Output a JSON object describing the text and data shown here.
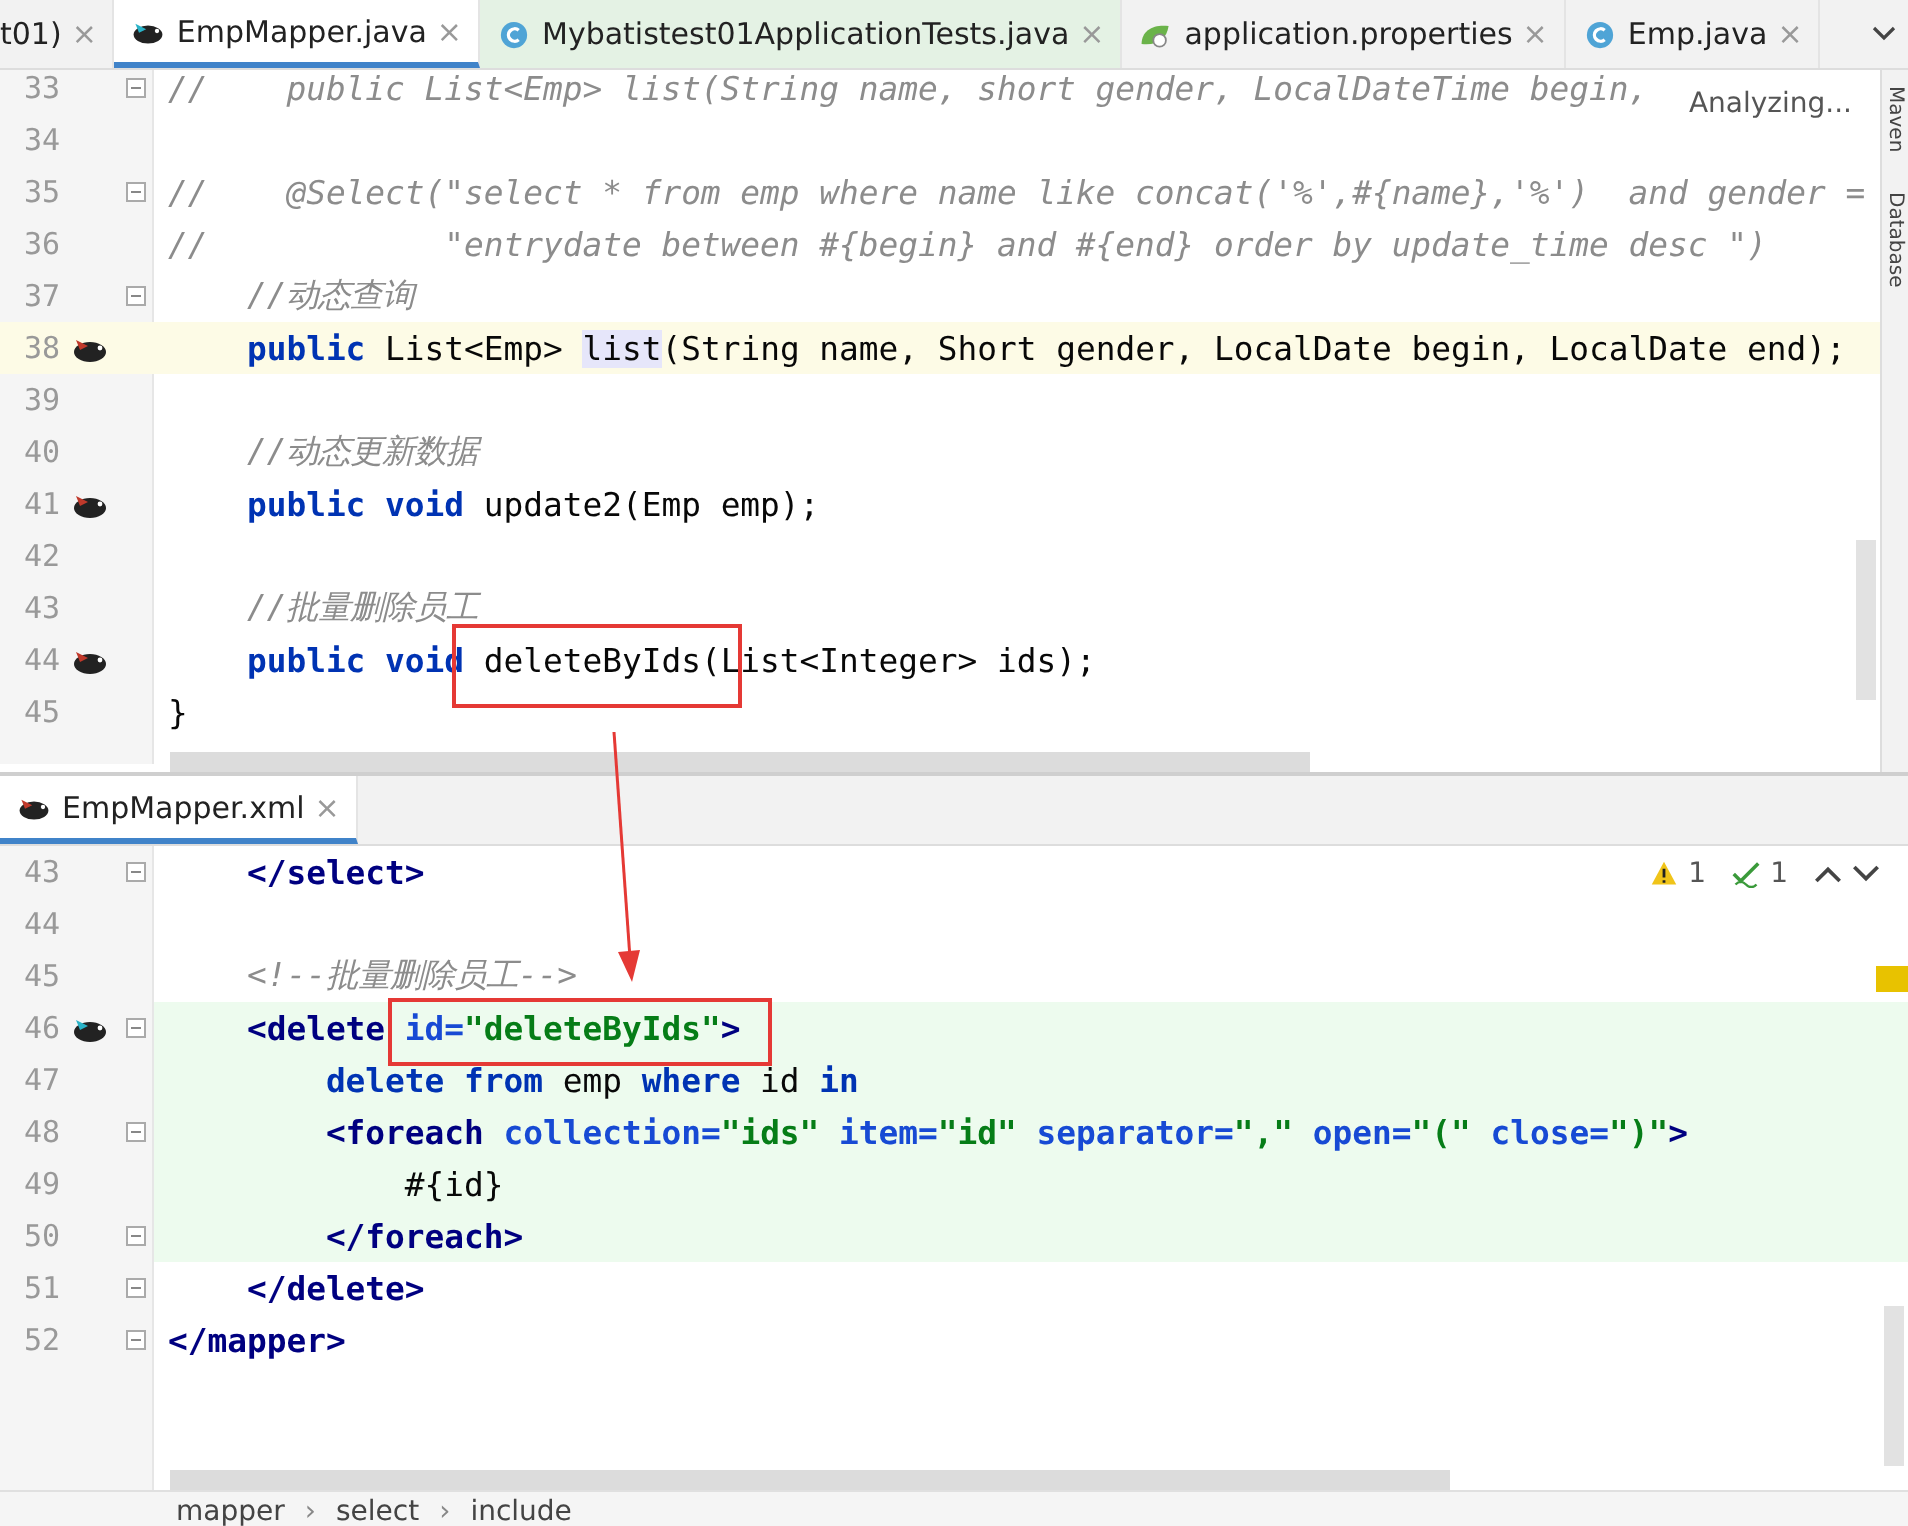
{
  "tabs": [
    {
      "label": "t01)",
      "close": "×",
      "selected": false,
      "kind": "plain",
      "tint": false
    },
    {
      "label": "EmpMapper.java",
      "close": "×",
      "selected": true,
      "kind": "mapper",
      "tint": false
    },
    {
      "label": "Mybatistest01ApplicationTests.java",
      "close": "×",
      "selected": false,
      "kind": "class",
      "tint": true
    },
    {
      "label": "application.properties",
      "close": "×",
      "selected": false,
      "kind": "config",
      "tint": false
    },
    {
      "label": "Emp.java",
      "close": "×",
      "selected": false,
      "kind": "class",
      "tint": false
    }
  ],
  "status_text": "Analyzing...",
  "side_labels": [
    "Maven",
    "Database"
  ],
  "java_editor": {
    "lines": [
      {
        "number": "33",
        "mapped": false,
        "fold": true,
        "current": false,
        "changed": false,
        "tokens": [
          {
            "kind": "comment",
            "text": "//    public List<Emp> list(String name, short gender, LocalDateTime begin,"
          }
        ]
      },
      {
        "number": "34",
        "mapped": false,
        "fold": false,
        "current": false,
        "changed": false
      },
      {
        "number": "35",
        "mapped": false,
        "fold": true,
        "current": false,
        "changed": false,
        "tokens": [
          {
            "kind": "comment",
            "text": "//    @Select(\"select * from emp where name like concat('%',#{name},'%')  and gender ="
          }
        ]
      },
      {
        "number": "36",
        "mapped": false,
        "fold": false,
        "current": false,
        "changed": false,
        "tokens": [
          {
            "kind": "comment",
            "text": "//            \"entrydate between #{begin} and #{end} order by update_time desc \")"
          }
        ]
      },
      {
        "number": "37",
        "mapped": false,
        "fold": true,
        "current": false,
        "changed": false,
        "tokens": [
          {
            "kind": "comment",
            "text": "    //动态查询"
          }
        ]
      },
      {
        "number": "38",
        "mapped": true,
        "fold": false,
        "current": true,
        "changed": false,
        "tokens": [
          {
            "kind": "kw",
            "text": "    public"
          },
          {
            "kind": "text",
            "text": " List<Emp> "
          },
          {
            "kind": "hl",
            "text": "list"
          },
          {
            "kind": "text",
            "text": "(String name, Short gender, LocalDate begin, LocalDate end);"
          }
        ]
      },
      {
        "number": "39",
        "mapped": false,
        "fold": false,
        "current": false,
        "changed": false
      },
      {
        "number": "40",
        "mapped": false,
        "fold": false,
        "current": false,
        "changed": false,
        "tokens": [
          {
            "kind": "comment",
            "text": "    //动态更新数据"
          }
        ]
      },
      {
        "number": "41",
        "mapped": true,
        "fold": false,
        "current": false,
        "changed": false,
        "tokens": [
          {
            "kind": "kw",
            "text": "    public void"
          },
          {
            "kind": "text",
            "text": " update2(Emp emp);"
          }
        ]
      },
      {
        "number": "42",
        "mapped": false,
        "fold": false,
        "current": false,
        "changed": false
      },
      {
        "number": "43",
        "mapped": false,
        "fold": false,
        "current": false,
        "changed": false,
        "tokens": [
          {
            "kind": "comment",
            "text": "    //批量删除员工"
          }
        ]
      },
      {
        "number": "44",
        "mapped": true,
        "fold": false,
        "current": false,
        "changed": false,
        "tokens": [
          {
            "kind": "kw",
            "text": "    public void"
          },
          {
            "kind": "text",
            "text": " deleteByIds(List<Integer> ids);"
          }
        ]
      },
      {
        "number": "45",
        "mapped": false,
        "fold": false,
        "current": false,
        "changed": false,
        "tokens": [
          {
            "kind": "text",
            "text": "}"
          }
        ]
      }
    ]
  },
  "xml_tab": {
    "label": "EmpMapper.xml",
    "close": "×",
    "selected": true
  },
  "inspections": {
    "warnings": "1",
    "typos": "1"
  },
  "xml_editor": {
    "lines": [
      {
        "number": "43",
        "mapped": false,
        "fold": true,
        "current": false,
        "changed": false,
        "tokens": [
          {
            "kind": "tag",
            "text": "    </select>"
          }
        ]
      },
      {
        "number": "44",
        "mapped": false,
        "fold": false,
        "current": false,
        "changed": false
      },
      {
        "number": "45",
        "mapped": false,
        "fold": false,
        "current": false,
        "changed": false,
        "tokens": [
          {
            "kind": "comment",
            "text": "    <!--批量删除员工-->"
          }
        ]
      },
      {
        "number": "46",
        "mapped": true,
        "fold": true,
        "current": false,
        "changed": true,
        "tokens": [
          {
            "kind": "tag",
            "text": "    <delete "
          },
          {
            "kind": "attr",
            "text": "id="
          },
          {
            "kind": "value",
            "text": "\"deleteByIds\""
          },
          {
            "kind": "tag",
            "text": ">"
          }
        ]
      },
      {
        "number": "47",
        "mapped": false,
        "fold": false,
        "current": false,
        "changed": true,
        "tokens": [
          {
            "kind": "kw",
            "text": "        delete from"
          },
          {
            "kind": "text",
            "text": " emp "
          },
          {
            "kind": "kw",
            "text": "where"
          },
          {
            "kind": "text",
            "text": " id "
          },
          {
            "kind": "kw",
            "text": "in"
          }
        ]
      },
      {
        "number": "48",
        "mapped": false,
        "fold": true,
        "current": false,
        "changed": true,
        "tokens": [
          {
            "kind": "tag",
            "text": "        <foreach "
          },
          {
            "kind": "attr",
            "text": "collection="
          },
          {
            "kind": "value",
            "text": "\"ids\" "
          },
          {
            "kind": "attr",
            "text": "item="
          },
          {
            "kind": "value",
            "text": "\"id\" "
          },
          {
            "kind": "attr",
            "text": "separator="
          },
          {
            "kind": "value",
            "text": "\",\" "
          },
          {
            "kind": "attr",
            "text": "open="
          },
          {
            "kind": "value",
            "text": "\"(\" "
          },
          {
            "kind": "attr",
            "text": "close="
          },
          {
            "kind": "value",
            "text": "\")\""
          },
          {
            "kind": "tag",
            "text": ">"
          }
        ]
      },
      {
        "number": "49",
        "mapped": false,
        "fold": false,
        "current": false,
        "changed": true,
        "tokens": [
          {
            "kind": "text",
            "text": "            #{id}"
          }
        ]
      },
      {
        "number": "50",
        "mapped": false,
        "fold": true,
        "current": false,
        "changed": true,
        "tokens": [
          {
            "kind": "tag",
            "text": "        </foreach>"
          }
        ]
      },
      {
        "number": "51",
        "mapped": false,
        "fold": true,
        "current": false,
        "changed": false,
        "tokens": [
          {
            "kind": "tag",
            "text": "    </delete>"
          }
        ]
      },
      {
        "number": "52",
        "mapped": false,
        "fold": true,
        "current": false,
        "changed": false,
        "tokens": [
          {
            "kind": "tag",
            "text": "</mapper>"
          }
        ]
      }
    ]
  },
  "breadcrumbs": [
    {
      "label": "mapper"
    },
    {
      "separator": "›",
      "label": "select"
    },
    {
      "separator": "›",
      "label": "include"
    }
  ]
}
